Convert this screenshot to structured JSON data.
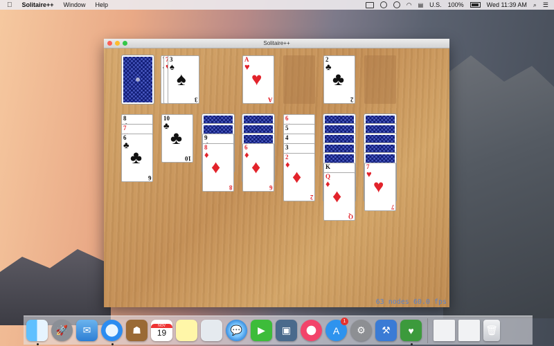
{
  "menubar": {
    "apple": "",
    "app_name": "Solitaire++",
    "menus": [
      "Window",
      "Help"
    ],
    "input_source": "U.S.",
    "battery": "100%",
    "clock": "Wed 11:39 AM"
  },
  "window": {
    "title": "Solitaire++",
    "status": "63 nodes  60.0 fps"
  },
  "dock": {
    "calendar_month": "NOV",
    "calendar_day": "19",
    "appstore_badge": "1",
    "icons": [
      "finder-icon",
      "launchpad-icon",
      "mail-icon",
      "safari-icon",
      "contacts-icon",
      "calendar-icon",
      "notes-icon",
      "preview-icon",
      "messages-icon",
      "facetime-icon",
      "photo-booth-icon",
      "itunes-icon",
      "app-store-icon",
      "system-preferences-icon",
      "xcode-icon",
      "solitaire-icon"
    ]
  },
  "colors": {
    "red_suit": "#e2232b",
    "felt": "#c9975d"
  },
  "cards": {
    "stock": "back",
    "waste": [
      "7♠",
      "7♥",
      "3♠"
    ],
    "foundations": [
      "A♥",
      "",
      "2♣",
      ""
    ],
    "tableau": [
      {
        "hidden": 0,
        "face_up": [
          "8♣",
          "7♥",
          "6♣"
        ]
      },
      {
        "hidden": 0,
        "face_up": [
          "10♣"
        ]
      },
      {
        "hidden": 2,
        "face_up": [
          "9♣",
          "8♦"
        ]
      },
      {
        "hidden": 3,
        "face_up": [
          "6♦"
        ]
      },
      {
        "hidden": 0,
        "face_up": [
          "6♥",
          "5♠",
          "4♠",
          "3♠",
          "2♦"
        ]
      },
      {
        "hidden": 5,
        "face_up": [
          "K♠",
          "Q♦"
        ]
      },
      {
        "hidden": 5,
        "face_up": [
          "7♥"
        ]
      }
    ]
  }
}
